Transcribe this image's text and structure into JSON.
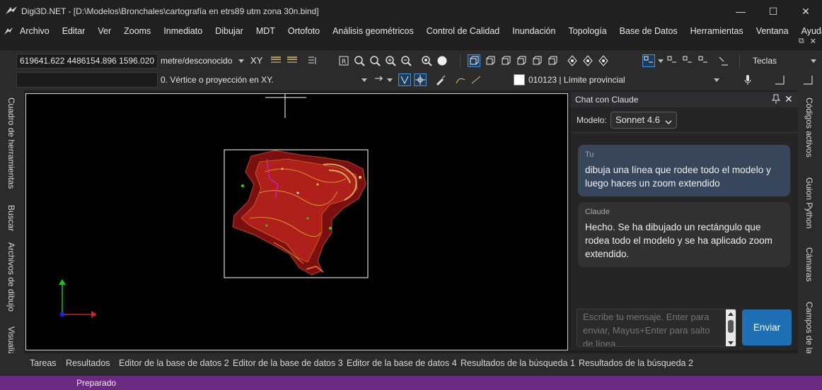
{
  "window": {
    "title": "Digi3D.NET - [D:\\Modelos\\Bronchales\\cartografía en etrs89 utm zona 30n.bind]",
    "minimize": "—",
    "maximize": "☐",
    "close": "✕"
  },
  "menu": [
    "Archivo",
    "Editar",
    "Ver",
    "Zooms",
    "Inmediato",
    "Dibujar",
    "MDT",
    "Ortofoto",
    "Análisis geométricos",
    "Control de Calidad",
    "Inundación",
    "Topología",
    "Base de Datos",
    "Herramientas",
    "Ventana",
    "Ayuda"
  ],
  "mdi": {
    "restore": "⧉",
    "close": "✕"
  },
  "toolbar": {
    "coordinates": "619641.622 4486154.896 1596.020",
    "units": "metre/desconocido",
    "xy_label": "XY",
    "snap_mode": "0. Vértice o proyección en XY.",
    "code": "010123 | Límite provincial",
    "keys_label": "Teclas"
  },
  "left_tabs": [
    "Cuadro de herramientas",
    "Buscar",
    "Archivos de dibujo",
    "Visualizació"
  ],
  "right_tabs": [
    "Códigos activos",
    "Guion Python",
    "Cámaras",
    "Campos de la base"
  ],
  "chat": {
    "title": "Chat con Claude",
    "model_label": "Modelo:",
    "model_value": "Sonnet 4.6",
    "messages": [
      {
        "author": "Tu",
        "text": "dibuja una línea que rodee todo el modelo y luego haces un zoom extendido"
      },
      {
        "author": "Claude",
        "text": "Hecho. Se ha dibujado un rectángulo que rodea todo el modelo y se ha aplicado zoom extendido."
      }
    ],
    "input_placeholder": "Escribe tu mensaje. Enter para enviar, Mayus+Enter para salto de línea.",
    "send_label": "Enviar"
  },
  "bottom_tabs": [
    "Tareas",
    "Resultados",
    "Editor de la base de datos 2",
    "Editor de la base de datos 3",
    "Editor de la base de datos 4",
    "Resultados de la búsqueda 1",
    "Resultados de la búsqueda 2"
  ],
  "status": "Preparado",
  "colors": {
    "accent": "#1f6fb5",
    "status_bar": "#6a2a82",
    "user_bubble": "#38465c",
    "model_stroke": "#b0201a",
    "bounding_rect": "#ffffff"
  }
}
